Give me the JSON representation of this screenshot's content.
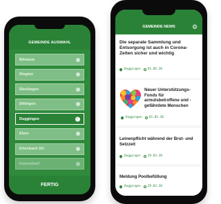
{
  "left_phone": {
    "header_title": "GEMEINDE AUSWAHL",
    "items": [
      {
        "label": "Bönnum"
      },
      {
        "label": "Diegten"
      },
      {
        "label": "Dinslingen"
      },
      {
        "label": "Dittingen"
      },
      {
        "label": "Duggingen",
        "selected": true
      },
      {
        "label": "Eben"
      },
      {
        "label": "Erlenbach SO"
      },
      {
        "label": "Fehrenborf"
      }
    ],
    "footer_button": "FERTIG"
  },
  "right_phone": {
    "header_title": "GEMEINDE NEWS",
    "settings_icon": "gear-icon",
    "news": [
      {
        "title": "Die separate Sammlung und Entsorgung ist auch in Corona-Zeiten sicher und wichtig",
        "location": "Duggingen",
        "date": "01.05.20"
      },
      {
        "title": "Neuer Unterstützungs-Fonds für armutsbetroffene und -gefährdete Menschen",
        "location": "Duggingen",
        "date": "01.05.20"
      },
      {
        "title": "Leinenpflicht während der Brut- und Setzzeit",
        "location": "Duggingen",
        "date": "29.03.20"
      },
      {
        "title": "Meldung Poolbefüllung",
        "location": "Duggingen",
        "date": "29.03.20"
      }
    ]
  },
  "colors": {
    "primary_green": "#2a8236",
    "list_green": "#7fbe86"
  }
}
